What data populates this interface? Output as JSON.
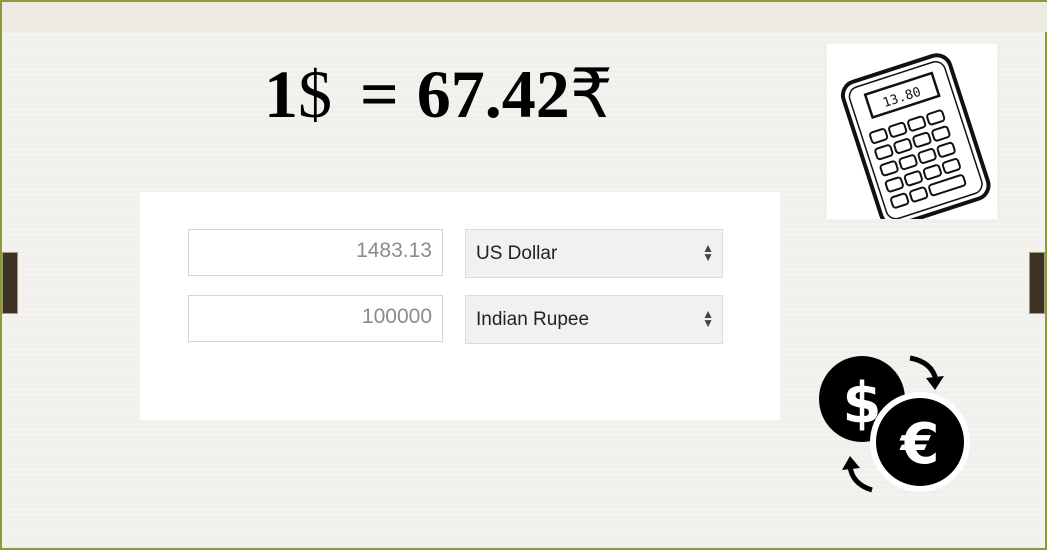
{
  "rate": {
    "lhs_number": "1",
    "lhs_symbol": "$",
    "equals": "=",
    "rhs_number": "67.42",
    "rhs_symbol": "₹"
  },
  "converter": {
    "row1": {
      "amount": "1483.13",
      "currency": "US Dollar"
    },
    "row2": {
      "amount": "100000",
      "currency": "Indian Rupee"
    }
  },
  "calculator_display": "13.80",
  "icons": {
    "calculator": "calculator-icon",
    "exchange": "currency-exchange-icon",
    "dollar": "$",
    "euro": "€"
  }
}
